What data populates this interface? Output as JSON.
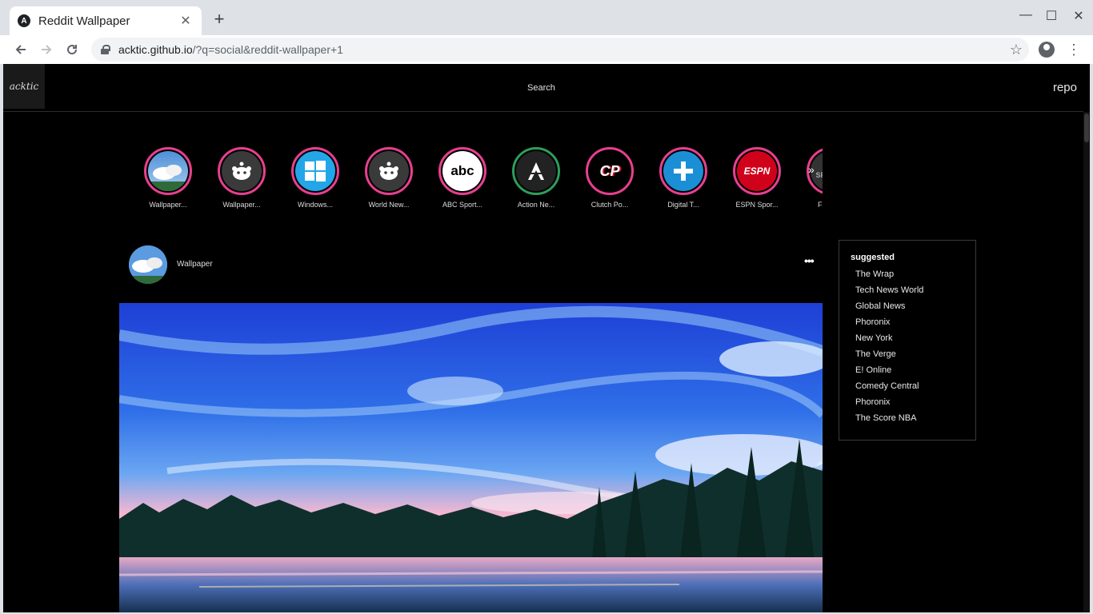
{
  "browser": {
    "tab_title": "Reddit Wallpaper",
    "tab_favicon": "A",
    "url_host": "acktic.github.io",
    "url_path": "/?q=social&reddit-wallpaper+1"
  },
  "site": {
    "logo": "acktic",
    "search_label": "Search",
    "repo_label": "repo"
  },
  "stories": [
    {
      "label": "Wallpaper...",
      "icon": "sky-icon"
    },
    {
      "label": "Wallpaper...",
      "icon": "reddit-icon"
    },
    {
      "label": "Windows...",
      "icon": "windows-icon"
    },
    {
      "label": "World New...",
      "icon": "reddit-icon"
    },
    {
      "label": "ABC Sport...",
      "icon": "abc-icon"
    },
    {
      "label": "Action Ne...",
      "icon": "action-icon"
    },
    {
      "label": "Clutch Po...",
      "icon": "cp-icon"
    },
    {
      "label": "Digital T...",
      "icon": "plus-icon"
    },
    {
      "label": "ESPN Spor...",
      "icon": "espn-icon"
    },
    {
      "label": "FOX Sp",
      "icon": "fox-icon"
    }
  ],
  "story_logos": {
    "abc": "abc",
    "cp": "CP",
    "espn": "ESPN",
    "fox": "FOX SPORTS"
  },
  "post": {
    "username": "Wallpaper",
    "more": "•••"
  },
  "suggested": {
    "title": "suggested",
    "items": [
      "The Wrap",
      "Tech News World",
      "Global News",
      "Phoronix",
      "New York",
      "The Verge",
      "E! Online",
      "Comedy Central",
      "Phoronix",
      "The Score NBA"
    ]
  },
  "colors": {
    "ring_pink": "#e83f8f",
    "ring_green": "#2d9e5a",
    "page_bg": "#000000"
  }
}
